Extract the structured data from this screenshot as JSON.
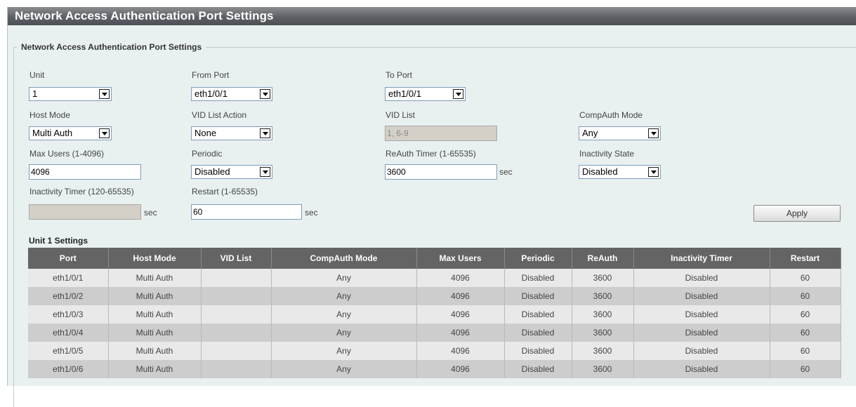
{
  "page": {
    "title": "Network Access Authentication Port Settings"
  },
  "form": {
    "legend": "Network Access Authentication Port Settings",
    "unit": {
      "label": "Unit",
      "value": "1"
    },
    "from_port": {
      "label": "From Port",
      "value": "eth1/0/1"
    },
    "to_port": {
      "label": "To Port",
      "value": "eth1/0/1"
    },
    "host_mode": {
      "label": "Host Mode",
      "value": "Multi Auth"
    },
    "vid_list_action": {
      "label": "VID List Action",
      "value": "None"
    },
    "vid_list": {
      "label": "VID List",
      "placeholder": "1, 6-9"
    },
    "compauth_mode": {
      "label": "CompAuth Mode",
      "value": "Any"
    },
    "max_users": {
      "label": "Max Users (1-4096)",
      "value": "4096"
    },
    "periodic": {
      "label": "Periodic",
      "value": "Disabled"
    },
    "reauth_timer": {
      "label": "ReAuth Timer (1-65535)",
      "value": "3600",
      "unit": "sec"
    },
    "inactivity_state": {
      "label": "Inactivity State",
      "value": "Disabled"
    },
    "inactivity_timer": {
      "label": "Inactivity Timer (120-65535)",
      "value": "",
      "unit": "sec"
    },
    "restart": {
      "label": "Restart (1-65535)",
      "value": "60",
      "unit": "sec"
    },
    "apply_label": "Apply"
  },
  "table": {
    "title": "Unit 1 Settings",
    "columns": [
      "Port",
      "Host Mode",
      "VID List",
      "CompAuth Mode",
      "Max Users",
      "Periodic",
      "ReAuth",
      "Inactivity Timer",
      "Restart"
    ],
    "rows": [
      [
        "eth1/0/1",
        "Multi Auth",
        "",
        "Any",
        "4096",
        "Disabled",
        "3600",
        "Disabled",
        "60"
      ],
      [
        "eth1/0/2",
        "Multi Auth",
        "",
        "Any",
        "4096",
        "Disabled",
        "3600",
        "Disabled",
        "60"
      ],
      [
        "eth1/0/3",
        "Multi Auth",
        "",
        "Any",
        "4096",
        "Disabled",
        "3600",
        "Disabled",
        "60"
      ],
      [
        "eth1/0/4",
        "Multi Auth",
        "",
        "Any",
        "4096",
        "Disabled",
        "3600",
        "Disabled",
        "60"
      ],
      [
        "eth1/0/5",
        "Multi Auth",
        "",
        "Any",
        "4096",
        "Disabled",
        "3600",
        "Disabled",
        "60"
      ],
      [
        "eth1/0/6",
        "Multi Auth",
        "",
        "Any",
        "4096",
        "Disabled",
        "3600",
        "Disabled",
        "60"
      ]
    ]
  }
}
